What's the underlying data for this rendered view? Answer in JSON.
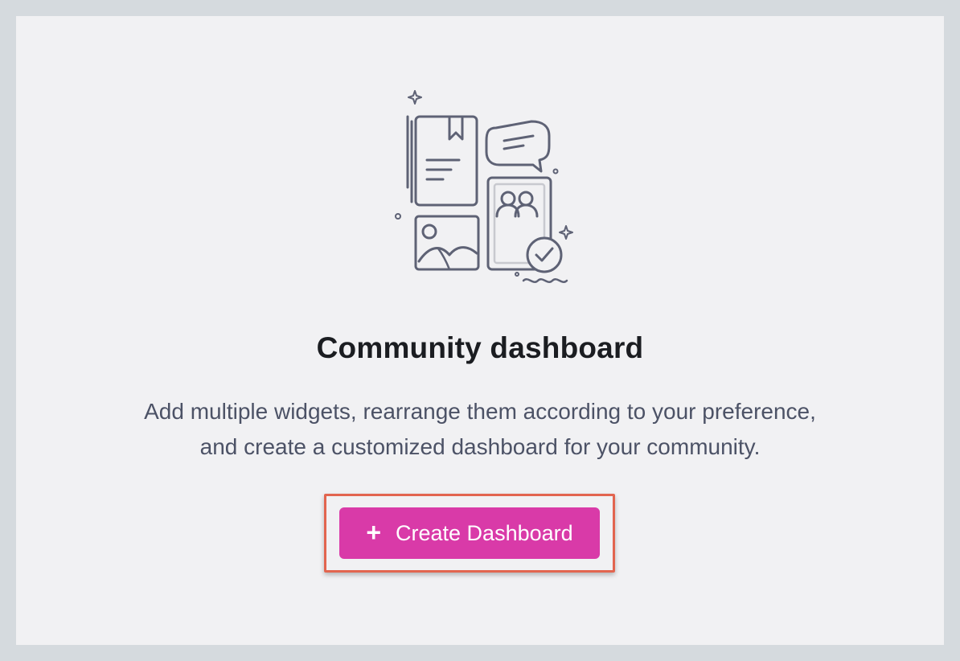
{
  "empty_state": {
    "illustration_icon": "dashboard-widgets-illustration-icon",
    "title": "Community dashboard",
    "description": "Add multiple widgets, rearrange them according to your preference, and create a customized dashboard for your community."
  },
  "actions": {
    "create_icon": "plus-icon",
    "create_plus": "+",
    "create_label": "Create Dashboard"
  },
  "colors": {
    "accent": "#d93aa8",
    "highlight_border": "#e2654f",
    "background": "#f1f1f3",
    "outer_background": "#d5dade"
  }
}
